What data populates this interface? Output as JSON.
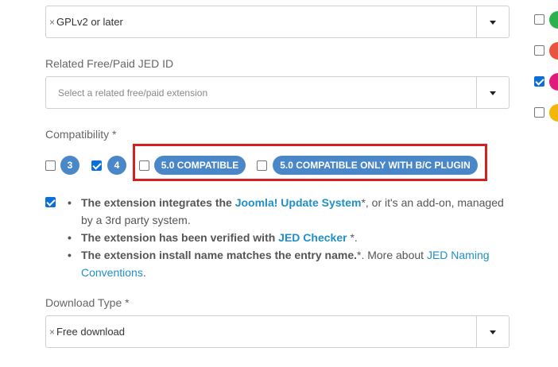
{
  "license_select": {
    "value": "GPLv2 or later",
    "remove_glyph": "×"
  },
  "related": {
    "label": "Related Free/Paid JED ID",
    "placeholder": "Select a related free/paid extension"
  },
  "compatibility": {
    "label": "Compatibility *",
    "options": [
      {
        "label": "3",
        "checked": false
      },
      {
        "label": "4",
        "checked": true
      },
      {
        "label": "5.0 COMPATIBLE",
        "checked": false
      },
      {
        "label": "5.0 COMPATIBLE ONLY WITH B/C PLUGIN",
        "checked": false
      }
    ]
  },
  "requirements": {
    "checked": true,
    "b1_bold": "The extension integrates the ",
    "b1_link": "Joomla! Update System",
    "b1_rest": "*, or it's an add-on, managed by a 3rd party system.",
    "b2_bold": "The extension has been verified with ",
    "b2_link": "JED Checker",
    "b2_rest": " *.",
    "b3_bold": "The extension install name matches the entry name.",
    "b3_rest": "*. More about ",
    "b3_link": "JED Naming Conventions",
    "b3_end": "."
  },
  "download_type": {
    "label": "Download Type *",
    "value": "Free download",
    "remove_glyph": "×"
  },
  "right_column": {
    "items": [
      {
        "checked": false,
        "color": "#2bb24c"
      },
      {
        "checked": false,
        "color": "#e8553e"
      },
      {
        "checked": true,
        "color": "#e0197a"
      },
      {
        "checked": false,
        "color": "#f2b705"
      }
    ]
  },
  "colors": {
    "badge": "#4a87c8",
    "highlight": "#d81f1f",
    "link": "#1f8fc6",
    "checkbox_checked": "#0b6fd8"
  }
}
